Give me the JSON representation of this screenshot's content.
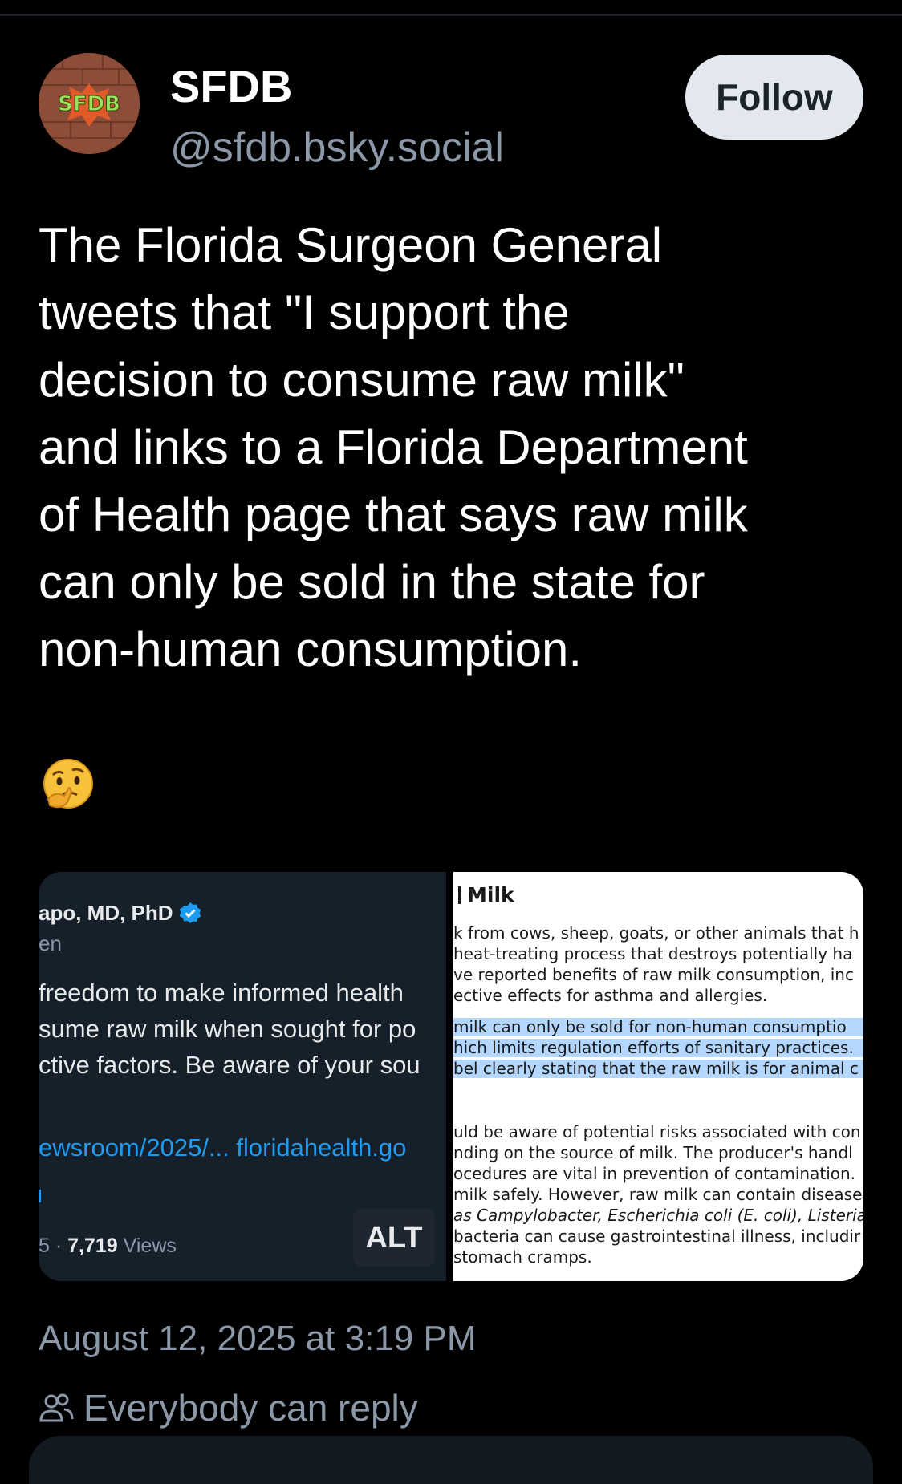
{
  "post": {
    "author": {
      "display_name": "SFDB",
      "handle": "@sfdb.bsky.social",
      "avatar_text": "SFDB"
    },
    "follow_label": "Follow",
    "text": "The Florida Surgeon General\ntweets that \"I support the\ndecision to consume raw milk\"\nand links to a Florida Department\nof Health page that says raw milk\ncan only be sold in the state for\nnon-human consumption.",
    "emoji": "thinking-face",
    "timestamp": "August 12, 2025 at 3:19 PM",
    "reply_setting": "Everybody can reply"
  },
  "media": {
    "alt_label": "ALT",
    "left_image": {
      "name": "apo, MD, PhD",
      "sub": "en",
      "lines": [
        "freedom to make informed health",
        "sume raw milk when sought for po",
        "ctive factors. Be aware of your sou"
      ],
      "link": "ewsroom/2025/... floridahealth.go",
      "views_prefix": "5 · ",
      "views_count": "7,719",
      "views_label": " Views"
    },
    "right_image": {
      "title": "Milk",
      "para1": [
        "k from cows, sheep, goats, or other animals that h",
        "heat-treating process that destroys potentially ha",
        "ve reported benefits of raw milk consumption, inc",
        "ective effects for asthma and allergies."
      ],
      "highlight": [
        "milk can only be sold for non-human consumptio",
        "hich limits regulation efforts of sanitary practices.",
        "bel clearly stating that the raw milk is for animal c"
      ],
      "para2": [
        "uld be aware of potential risks associated with con",
        "nding on the source of milk. The producer's handl",
        "ocedures are vital in prevention of contamination.",
        "milk safely. However, raw milk can contain disease",
        "as Campylobacter, Escherichia coli (E. coli), Listeria, S",
        "bacteria can cause gastrointestinal illness, includir",
        "stomach cramps."
      ]
    }
  },
  "colors": {
    "background": "#000000",
    "muted_text": "#8b98a8",
    "follow_bg": "#e3e8ee",
    "link_blue": "#1d9bf0",
    "highlight": "#b3d7ff"
  }
}
